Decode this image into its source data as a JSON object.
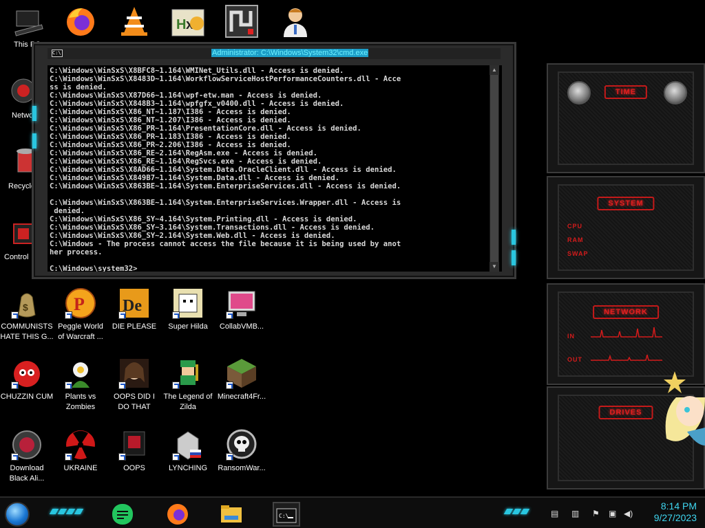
{
  "desktop": {
    "left_partial_icons": [
      {
        "label": "This PC"
      },
      {
        "label": "Netwo"
      },
      {
        "label": "Recycle"
      },
      {
        "label": "Control"
      }
    ],
    "icons_row1": [
      {
        "label": "COMMUNISTS HATE THIS G...",
        "icon": "money-bag-icon"
      },
      {
        "label": "Peggle World of Warcraft ...",
        "icon": "peggle-icon"
      },
      {
        "label": "DIE PLEASE",
        "icon": "die-icon"
      },
      {
        "label": "Super Hilda",
        "icon": "hilda-icon"
      },
      {
        "label": "CollabVMB...",
        "icon": "monitor-icon"
      }
    ],
    "icons_row2": [
      {
        "label": "CHUZZIN CUM",
        "icon": "chuzzle-icon"
      },
      {
        "label": "Plants vs Zombies",
        "icon": "plant-icon"
      },
      {
        "label": "OOPS DID I DO THAT",
        "icon": "portrait-icon"
      },
      {
        "label": "The Legend of Zilda",
        "icon": "zelda-icon"
      },
      {
        "label": "Minecraft4Fr...",
        "icon": "minecraft-icon"
      }
    ],
    "icons_row3": [
      {
        "label": "Download Black Ali...",
        "icon": "alien-icon"
      },
      {
        "label": "UKRAINE",
        "icon": "radiation-icon"
      },
      {
        "label": "OOPS",
        "icon": "oops-icon"
      },
      {
        "label": "LYNCHING",
        "icon": "lynching-icon"
      },
      {
        "label": "RansomWar...",
        "icon": "skull-icon"
      }
    ]
  },
  "cmd": {
    "title": "Administrator: C:\\Windows\\System32\\cmd.exe",
    "icon_text": "C:\\",
    "output": "C:\\Windows\\WinSxS\\X8BFC8~1.164\\WMINet_Utils.dll - Access is denied.\nC:\\Windows\\WinSxS\\X8483D~1.164\\WorkflowServiceHostPerformanceCounters.dll - Acce\nss is denied.\nC:\\Windows\\WinSxS\\X87D66~1.164\\wpf-etw.man - Access is denied.\nC:\\Windows\\WinSxS\\X848B3~1.164\\wpfgfx_v0400.dll - Access is denied.\nC:\\Windows\\WinSxS\\X86_NT~1.187\\I386 - Access is denied.\nC:\\Windows\\WinSxS\\X86_NT~1.207\\I386 - Access is denied.\nC:\\Windows\\WinSxS\\X86_PR~1.164\\PresentationCore.dll - Access is denied.\nC:\\Windows\\WinSxS\\X86_PR~1.183\\I386 - Access is denied.\nC:\\Windows\\WinSxS\\X86_PR~2.206\\I386 - Access is denied.\nC:\\Windows\\WinSxS\\X86_RE~2.164\\RegAsm.exe - Access is denied.\nC:\\Windows\\WinSxS\\X86_RE~1.164\\RegSvcs.exe - Access is denied.\nC:\\Windows\\WinSxS\\X8AD66~1.164\\System.Data.OracleClient.dll - Access is denied.\nC:\\Windows\\WinSxS\\X849B7~1.164\\System.Data.dll - Access is denied.\nC:\\Windows\\WinSxS\\X863BE~1.164\\System.EnterpriseServices.dll - Access is denied.\n\nC:\\Windows\\WinSxS\\X863BE~1.164\\System.EnterpriseServices.Wrapper.dll - Access is\n denied.\nC:\\Windows\\WinSxS\\X86_SY~4.164\\System.Printing.dll - Access is denied.\nC:\\Windows\\WinSxS\\X86_SY~3.164\\System.Transactions.dll - Access is denied.\nC:\\Windows\\WinSxS\\X86_SY~2.164\\System.Web.dll - Access is denied.\nC:\\Windows - The process cannot access the file because it is being used by anot\nher process.\n\nC:\\Windows\\system32>_"
  },
  "gadgets": {
    "time": {
      "title": "TIME"
    },
    "system": {
      "title": "SYSTEM",
      "labels": [
        "CPU",
        "RAM",
        "SWAP"
      ]
    },
    "network": {
      "title": "NETWORK",
      "labels": [
        "IN",
        "OUT"
      ]
    },
    "drives": {
      "title": "DRIVES"
    }
  },
  "taskbar": {
    "time": "8:14 PM",
    "date": "9/27/2023",
    "accent": "#29c6e0"
  }
}
